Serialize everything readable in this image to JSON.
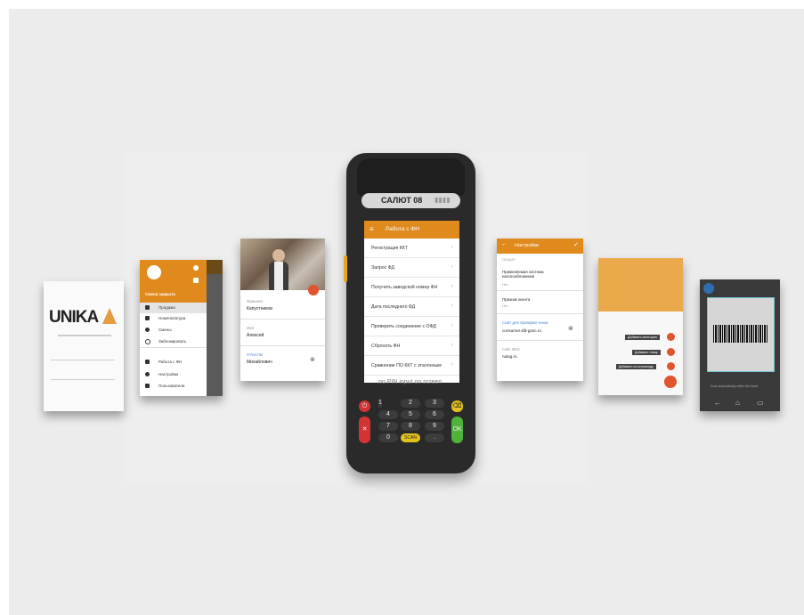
{
  "colors": {
    "accent": "#e08a1e",
    "background": "#ececec",
    "device": "#2a2a2a"
  },
  "unika": {
    "logo": "UNIKA",
    "subtitle": "",
    "field1_label": "",
    "field1_value": "",
    "field2_label": ""
  },
  "menu": {
    "shift_label": "Смена закрыта",
    "items": [
      {
        "label": "Продажа",
        "icon": "person-icon"
      },
      {
        "label": "Номенклатура",
        "icon": "bag-icon"
      },
      {
        "label": "Смены",
        "icon": "dot-icon"
      },
      {
        "label": "Заблокировать",
        "icon": "lock-circle-icon"
      },
      {
        "label": "Работа с ФН",
        "icon": "grid-icon"
      },
      {
        "label": "Настройки",
        "icon": "gear-icon"
      },
      {
        "label": "Пользователи",
        "icon": "users-icon"
      }
    ]
  },
  "profile": {
    "fields": [
      {
        "label": "Фамилия",
        "value": "Капустников"
      },
      {
        "label": "Имя",
        "value": "Алексей"
      },
      {
        "label": "Отчество",
        "value": "Михайлович"
      }
    ]
  },
  "device": {
    "brand": "САЛЮТ 08",
    "screen_title": "Работа с ФН",
    "note": "no PIN input on screen",
    "rows": [
      "Регистрация ККТ",
      "Запрос ФД",
      "Получить заводской номер ФН",
      "Дата последнего ФД",
      "Проверить соединение с ОФД",
      "Сбросить ФН",
      "Сравнение ПО ККТ с эталонным"
    ],
    "keys": {
      "row1": [
        "1",
        "2",
        "3"
      ],
      "row2": [
        "4",
        "5",
        "6"
      ],
      "row3": [
        "7",
        "8",
        "9"
      ],
      "row4": [
        "0",
        "SCAN",
        "."
      ],
      "ok": "OK"
    }
  },
  "settings": {
    "title": "Настройки",
    "section": "ОБЩИЕ",
    "items": [
      {
        "label": "Применяемая система налогообложения",
        "value": "Нет"
      },
      {
        "label": "Признак агента",
        "value": "Нет"
      },
      {
        "label": "Сайт для проверки чеков",
        "value": "consumer.sfd-gosc.ru"
      },
      {
        "label": "Сайт ФНС",
        "value": "nalog.ru"
      }
    ]
  },
  "popup": {
    "actions": [
      "Добавить категорию",
      "Добавить товар",
      "Добавить по штрихкоду"
    ]
  },
  "scanner": {
    "hint": "Scan automatically within the frame"
  }
}
